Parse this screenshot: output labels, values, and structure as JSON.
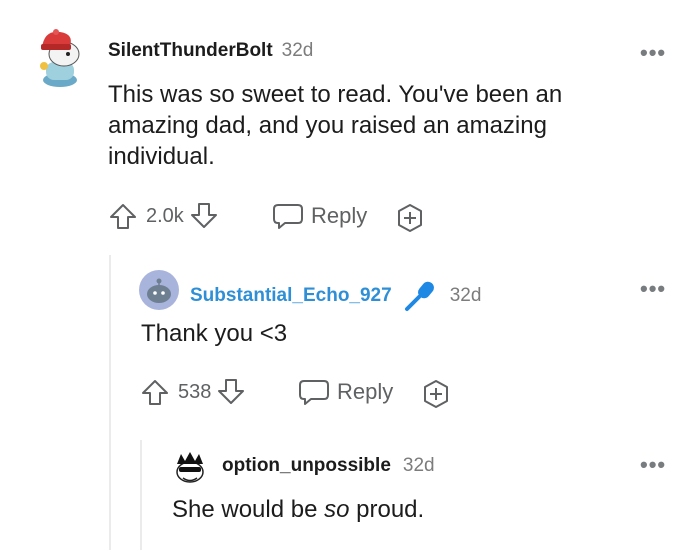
{
  "comments": [
    {
      "username": "SilentThunderBolt",
      "time": "32d",
      "body": [
        "This was so sweet to read. You've been an",
        "amazing dad, and you raised an amazing",
        "individual."
      ],
      "votes": "2.0k",
      "reply_label": "Reply",
      "avatar_icon": "snoo-red-beanie-avatar"
    },
    {
      "username": "Substantial_Echo_927",
      "time": "32d",
      "body": [
        "Thank you <3"
      ],
      "votes": "538",
      "reply_label": "Reply",
      "badge_icon": "microphone-icon",
      "username_color": "#2f8fd6"
    },
    {
      "username": "option_unpossible",
      "time": "32d",
      "body_prefix": "She would be ",
      "body_emphasis": "so",
      "body_suffix": " proud."
    }
  ],
  "more_label": "•••"
}
